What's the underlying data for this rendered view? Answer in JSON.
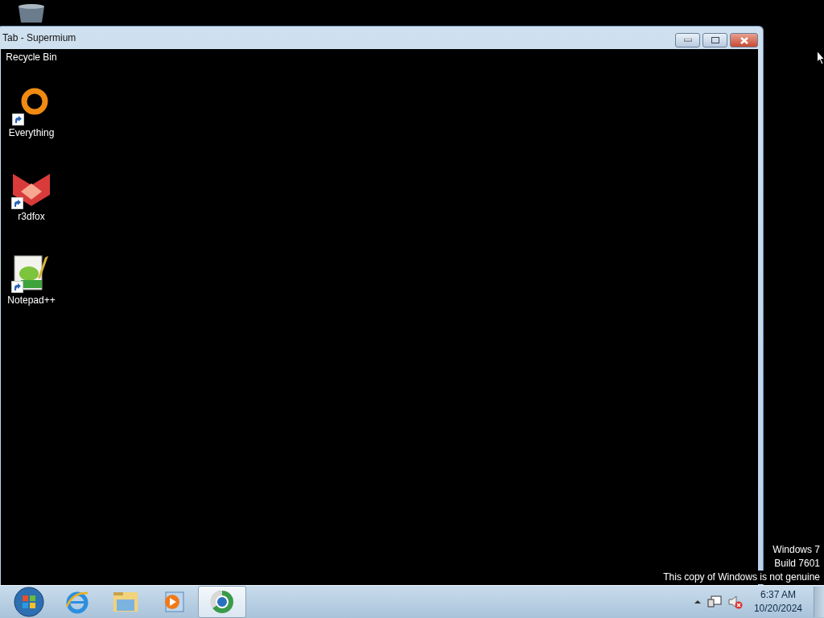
{
  "window": {
    "title": "Tab - Supermium"
  },
  "desktop_icons": [
    {
      "kind": "recycle",
      "label": "Recycle Bin"
    },
    {
      "kind": "everything",
      "label": "Everything"
    },
    {
      "kind": "r3dfox",
      "label": "r3dfox"
    },
    {
      "kind": "notepad",
      "label": "Notepad++"
    }
  ],
  "notice": [
    "Windows 7",
    "Build 7601",
    "This copy of Windows is not genuine"
  ],
  "taskbar": {
    "items": [
      {
        "kind": "start",
        "selected": false
      },
      {
        "kind": "ie",
        "selected": false
      },
      {
        "kind": "explorer",
        "selected": false
      },
      {
        "kind": "media",
        "selected": false
      },
      {
        "kind": "browser",
        "selected": true
      }
    ],
    "clock": {
      "time": "6:37 AM",
      "date": "10/20/2024"
    }
  }
}
